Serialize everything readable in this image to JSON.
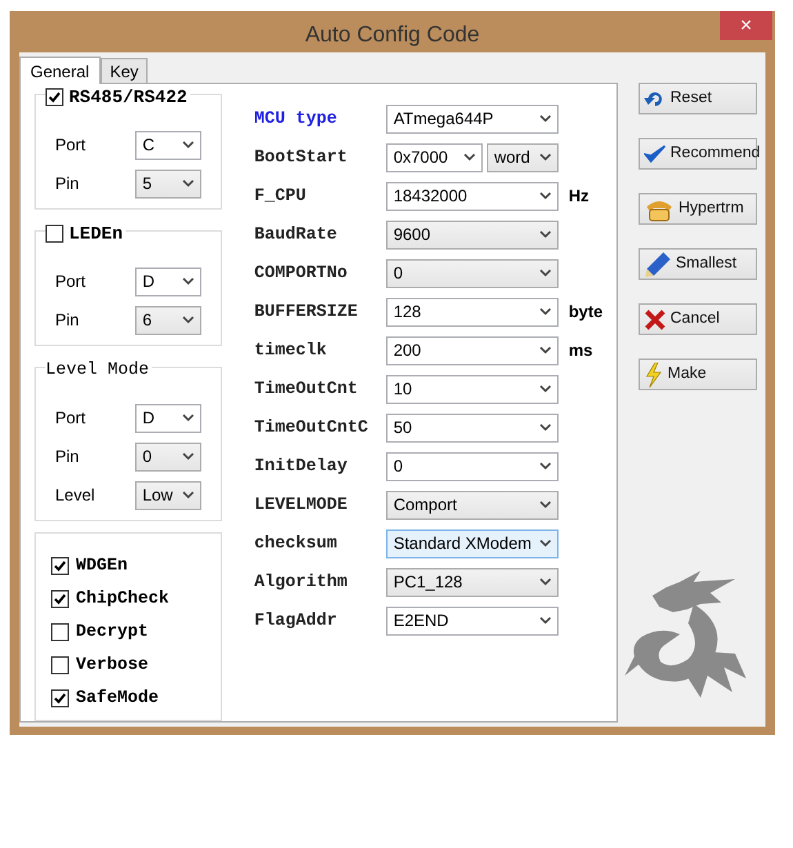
{
  "window": {
    "title": "Auto Config Code",
    "close": "×"
  },
  "tabs": [
    {
      "label": "General",
      "selected": true
    },
    {
      "label": "Key",
      "selected": false
    }
  ],
  "groups": [
    {
      "kind": "checkbox",
      "title": "RS485/RS422",
      "checked": true,
      "fields": [
        {
          "label": "Port",
          "value": "C",
          "kind": "edit"
        },
        {
          "label": "Pin",
          "value": "5",
          "kind": "list"
        }
      ]
    },
    {
      "kind": "checkbox",
      "title": "LEDEn",
      "checked": false,
      "fields": [
        {
          "label": "Port",
          "value": "D",
          "kind": "edit"
        },
        {
          "label": "Pin",
          "value": "6",
          "kind": "list"
        }
      ]
    },
    {
      "kind": "caption",
      "title": "Level Mode",
      "fields": [
        {
          "label": "Port",
          "value": "D",
          "kind": "edit"
        },
        {
          "label": "Pin",
          "value": "0",
          "kind": "list"
        },
        {
          "label": "Level",
          "value": "Low",
          "kind": "list"
        }
      ]
    }
  ],
  "options": [
    {
      "label": "WDGEn",
      "checked": true
    },
    {
      "label": "ChipCheck",
      "checked": true
    },
    {
      "label": "Decrypt",
      "checked": false
    },
    {
      "label": "Verbose",
      "checked": false
    },
    {
      "label": "SafeMode",
      "checked": true
    }
  ],
  "settings": [
    {
      "label": "MCU type",
      "accent": true,
      "controls": [
        {
          "value": "ATmega644P",
          "kind": "edit",
          "focused": false
        }
      ]
    },
    {
      "label": "BootStart",
      "accent": false,
      "controls": [
        {
          "value": "0x7000",
          "kind": "edit",
          "focused": false
        },
        {
          "value": "word",
          "kind": "list",
          "focused": false
        }
      ]
    },
    {
      "label": "F_CPU",
      "accent": false,
      "controls": [
        {
          "value": "18432000",
          "kind": "edit",
          "focused": false
        }
      ],
      "unit": "Hz"
    },
    {
      "label": "BaudRate",
      "accent": false,
      "controls": [
        {
          "value": "9600",
          "kind": "list",
          "focused": false
        }
      ]
    },
    {
      "label": "COMPORTNo",
      "accent": false,
      "controls": [
        {
          "value": "0",
          "kind": "list",
          "focused": false
        }
      ]
    },
    {
      "label": "BUFFERSIZE",
      "accent": false,
      "controls": [
        {
          "value": "128",
          "kind": "edit",
          "focused": false
        }
      ],
      "unit": "byte"
    },
    {
      "label": "timeclk",
      "accent": false,
      "controls": [
        {
          "value": "200",
          "kind": "edit",
          "focused": false
        }
      ],
      "unit": "ms"
    },
    {
      "label": "TimeOutCnt",
      "accent": false,
      "controls": [
        {
          "value": "10",
          "kind": "edit",
          "focused": false
        }
      ]
    },
    {
      "label": "TimeOutCntC",
      "accent": false,
      "controls": [
        {
          "value": "50",
          "kind": "edit",
          "focused": false
        }
      ]
    },
    {
      "label": "InitDelay",
      "accent": false,
      "controls": [
        {
          "value": "0",
          "kind": "edit",
          "focused": false
        }
      ]
    },
    {
      "label": "LEVELMODE",
      "accent": false,
      "controls": [
        {
          "value": "Comport",
          "kind": "list",
          "focused": false
        }
      ]
    },
    {
      "label": "checksum",
      "accent": false,
      "controls": [
        {
          "value": "Standard XModem",
          "kind": "list",
          "focused": true
        }
      ]
    },
    {
      "label": "Algorithm",
      "accent": false,
      "controls": [
        {
          "value": "PC1_128",
          "kind": "list",
          "focused": false
        }
      ]
    },
    {
      "label": "FlagAddr",
      "accent": false,
      "controls": [
        {
          "value": "E2END",
          "kind": "edit",
          "focused": false
        }
      ]
    }
  ],
  "buttons": [
    {
      "label": "Reset"
    },
    {
      "label": "Recommend"
    },
    {
      "label": "Hypertrm"
    },
    {
      "label": "Smallest"
    },
    {
      "label": "Cancel"
    },
    {
      "label": "Make"
    }
  ]
}
